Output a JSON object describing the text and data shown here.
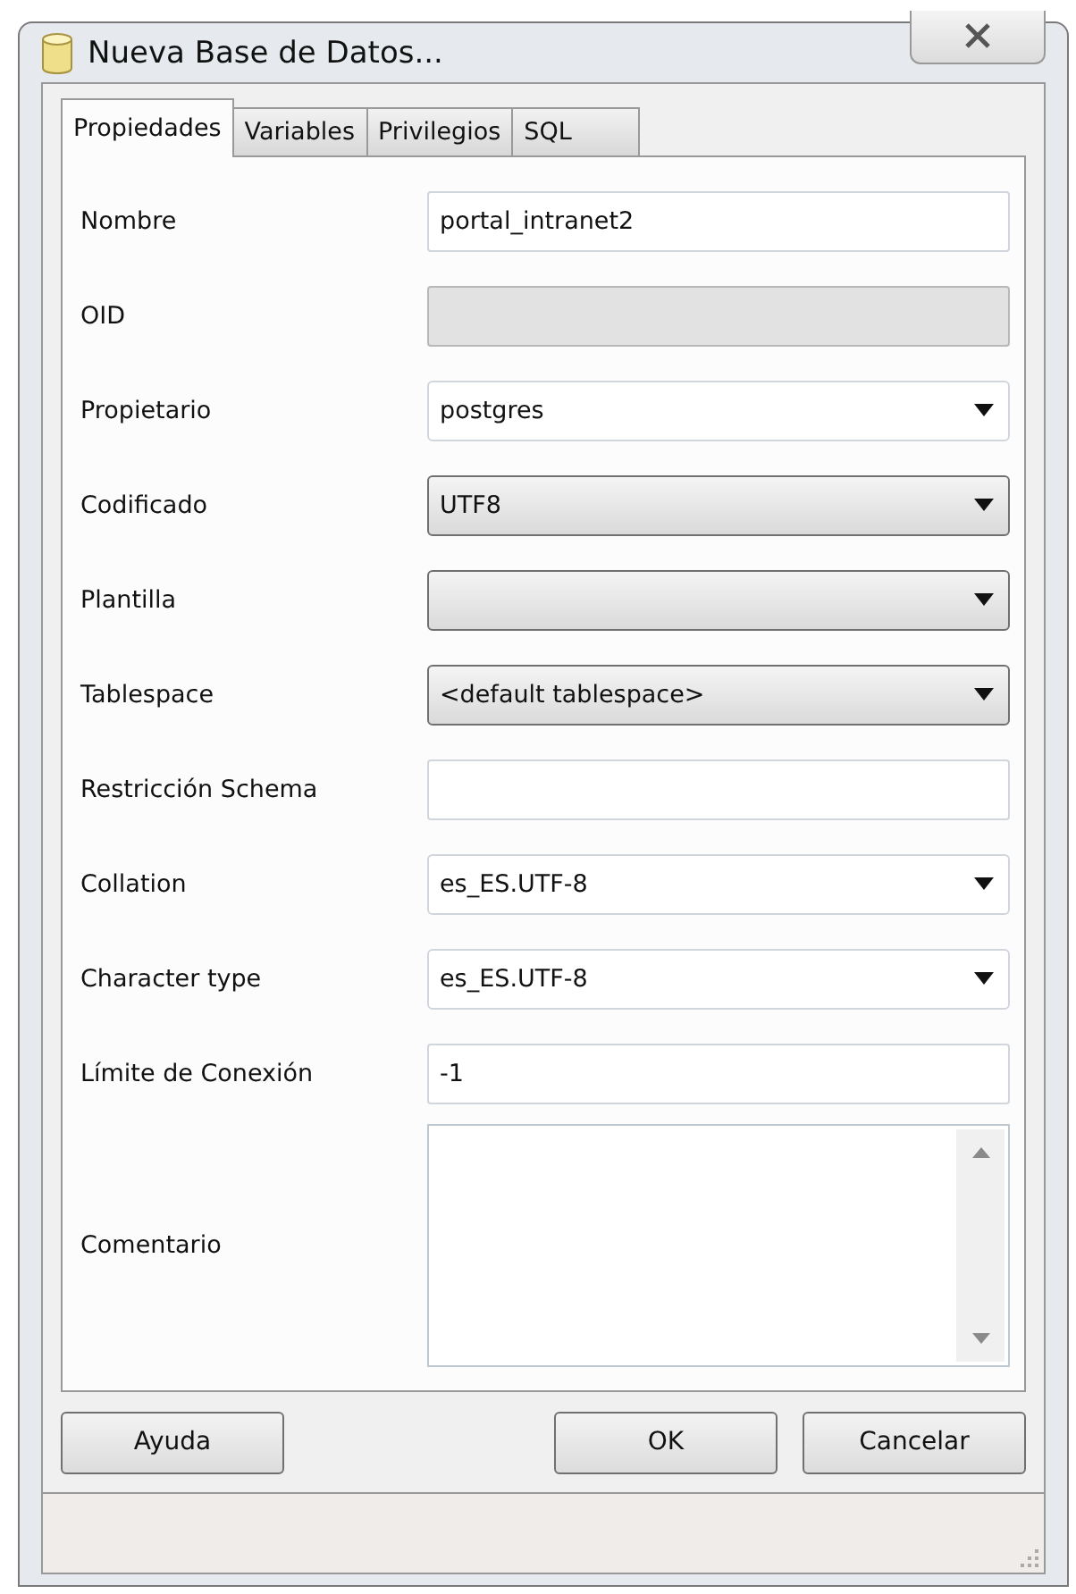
{
  "window": {
    "title": "Nueva Base de Datos..."
  },
  "tabs": [
    {
      "label": "Propiedades",
      "selected": true
    },
    {
      "label": "Variables",
      "selected": false
    },
    {
      "label": "Privilegios",
      "selected": false
    },
    {
      "label": "SQL",
      "selected": false
    }
  ],
  "fields": [
    {
      "label": "Nombre",
      "kind": "text",
      "value": "portal_intranet2",
      "disabled": false
    },
    {
      "label": "OID",
      "kind": "text",
      "disabled": true
    },
    {
      "label": "Propietario",
      "kind": "combo",
      "value": "postgres"
    },
    {
      "label": "Codificado",
      "kind": "dropdown",
      "value": "UTF8"
    },
    {
      "label": "Plantilla",
      "kind": "dropdown"
    },
    {
      "label": "Tablespace",
      "kind": "dropdown",
      "value": "<default tablespace>"
    },
    {
      "label": "Restricción Schema",
      "kind": "text",
      "disabled": false
    },
    {
      "label": "Collation",
      "kind": "combo",
      "value": "es_ES.UTF-8"
    },
    {
      "label": "Character type",
      "kind": "combo",
      "value": "es_ES.UTF-8"
    },
    {
      "label": "Límite de Conexión",
      "kind": "text",
      "value": "-1",
      "disabled": false
    },
    {
      "label": "Comentario",
      "kind": "textarea"
    }
  ],
  "buttons": {
    "left": [
      "Ayuda"
    ],
    "right": [
      "OK",
      "Cancelar"
    ]
  }
}
